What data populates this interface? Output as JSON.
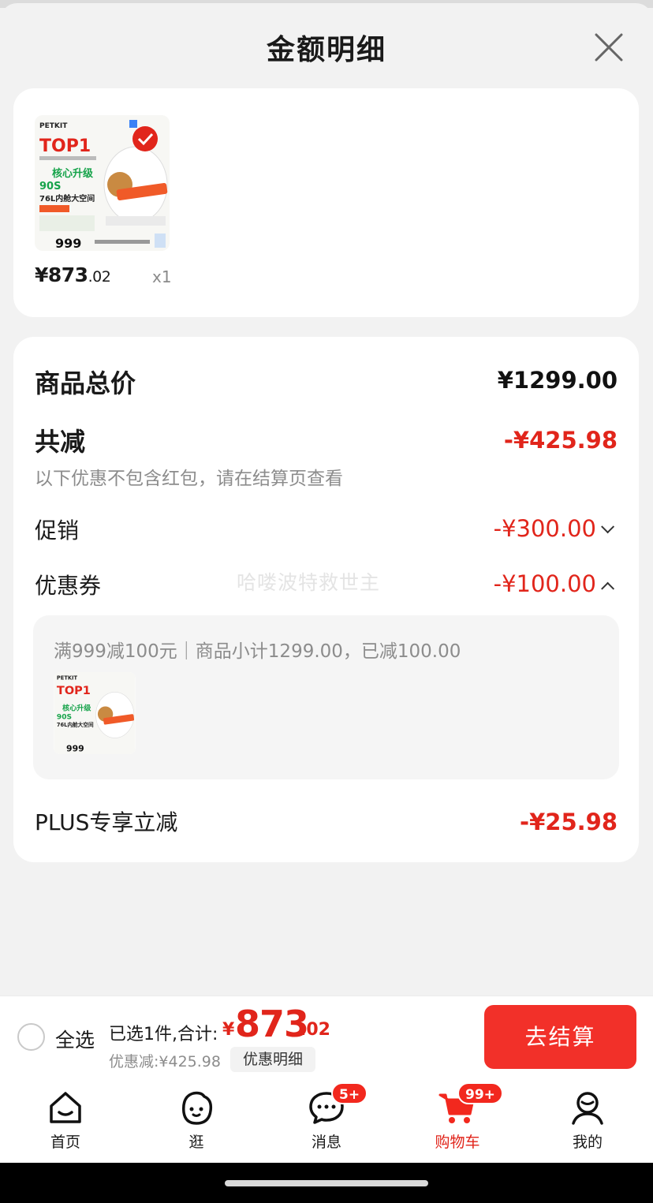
{
  "title": "金额明细",
  "product": {
    "price_int": "¥873",
    "price_dec": ".02",
    "qty": "x1",
    "img_brand": "PETKIT",
    "img_top": "TOP1",
    "img_line1": "核心升级",
    "img_line2": "90S",
    "img_line3": "76L内舱大空间",
    "img_num": "999"
  },
  "summary": {
    "total_label": "商品总价",
    "total_value": "¥1299.00",
    "reduce_label": "共减",
    "reduce_value": "-¥425.98",
    "note": "以下优惠不包含红包，请在结算页查看",
    "promo_label": "促销",
    "promo_value": "-¥300.00",
    "coupon_label": "优惠券",
    "coupon_value": "-¥100.00",
    "watermark": "哈喽波特救世主",
    "coupon_detail": "满999减100元｜商品小计1299.00，已减100.00",
    "plus_label": "PLUS专享立减",
    "plus_value": "-¥25.98"
  },
  "bottom": {
    "select_all": "全选",
    "selected": "已选1件,合计:",
    "total_yen": "¥",
    "total_int": "873",
    "total_dec": ".02",
    "discount": "优惠减:¥425.98",
    "detail_btn": "优惠明细",
    "checkout": "去结算"
  },
  "tabs": [
    {
      "label": "首页",
      "icon": "home-icon"
    },
    {
      "label": "逛",
      "icon": "face-icon"
    },
    {
      "label": "消息",
      "icon": "chat-icon",
      "badge": "5+"
    },
    {
      "label": "购物车",
      "icon": "cart-icon",
      "badge": "99+"
    },
    {
      "label": "我的",
      "icon": "user-icon"
    }
  ],
  "colors": {
    "accent": "#e1251b",
    "button": "#f23029"
  }
}
